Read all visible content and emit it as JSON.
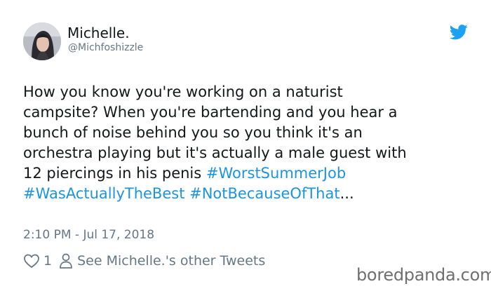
{
  "author": {
    "display_name": "Michelle.",
    "handle": "@Michfoshizzle"
  },
  "tweet": {
    "line1": "How you know you're working on a naturist",
    "line2": "campsite? When you're bartending and you hear a",
    "line3": "bunch of noise behind you so you think it's an",
    "line4": "orchestra playing but it's actually a male guest with",
    "line5_text": "12 piercings in his penis ",
    "hashtag1": "#WorstSummerJob",
    "hashtag2": "#WasActuallyTheBest",
    "hashtag3": "#NotBecauseOfThat",
    "ellipsis": "...",
    "timestamp": "2:10 PM - Jul 17, 2018"
  },
  "actions": {
    "like_count": "1",
    "profile_link": "See Michelle.'s other Tweets"
  },
  "watermark": "boredpanda.com",
  "colors": {
    "hashtag": "#1b95e0",
    "twitter_blue": "#1da1f2",
    "secondary_text": "#657786"
  },
  "icons": [
    "avatar-photo",
    "twitter-bird-icon",
    "heart-icon",
    "person-icon"
  ]
}
